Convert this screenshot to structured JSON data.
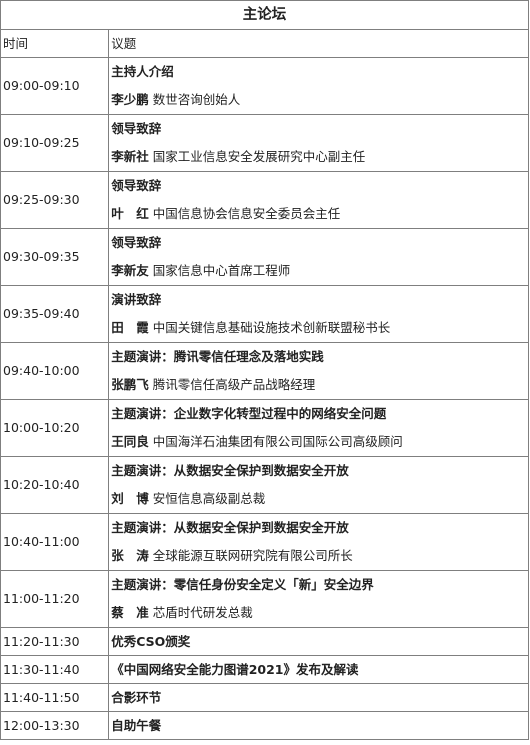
{
  "title": "主论坛",
  "headers": {
    "time": "时间",
    "topic": "议题"
  },
  "sessions": [
    {
      "time": "09:00-09:10",
      "topic": "主持人介绍",
      "speaker": "李少鹏",
      "role": "数世咨询创始人"
    },
    {
      "time": "09:10-09:25",
      "topic": "领导致辞",
      "speaker": "李新社",
      "role": "国家工业信息安全发展研究中心副主任"
    },
    {
      "time": "09:25-09:30",
      "topic": "领导致辞",
      "speaker": "叶　红",
      "role": "中国信息协会信息安全委员会主任"
    },
    {
      "time": "09:30-09:35",
      "topic": "领导致辞",
      "speaker": "李新友",
      "role": "国家信息中心首席工程师"
    },
    {
      "time": "09:35-09:40",
      "topic": "演讲致辞",
      "speaker": "田　霞",
      "role": "中国关键信息基础设施技术创新联盟秘书长"
    },
    {
      "time": "09:40-10:00",
      "topic": "主题演讲：腾讯零信任理念及落地实践",
      "speaker": "张鹏飞",
      "role": "腾讯零信任高级产品战略经理"
    },
    {
      "time": "10:00-10:20",
      "topic": "主题演讲：企业数字化转型过程中的网络安全问题",
      "speaker": "王同良",
      "role": "中国海洋石油集团有限公司国际公司高级顾问"
    },
    {
      "time": "10:20-10:40",
      "topic": "主题演讲：从数据安全保护到数据安全开放",
      "speaker": "刘　博",
      "role": "安恒信息高级副总裁"
    },
    {
      "time": "10:40-11:00",
      "topic": "主题演讲：从数据安全保护到数据安全开放",
      "speaker": "张　涛",
      "role": "全球能源互联网研究院有限公司所长"
    },
    {
      "time": "11:00-11:20",
      "topic": "主题演讲：零信任身份安全定义「新」安全边界",
      "speaker": "蔡　准",
      "role": "芯盾时代研发总裁"
    }
  ],
  "single_sessions": [
    {
      "time": "11:20-11:30",
      "topic": "优秀CSO颁奖"
    },
    {
      "time": "11:30-11:40",
      "topic": "《中国网络安全能力图谱2021》发布及解读"
    },
    {
      "time": "11:40-11:50",
      "topic": "合影环节"
    },
    {
      "time": "12:00-13:30",
      "topic": "自助午餐"
    }
  ]
}
